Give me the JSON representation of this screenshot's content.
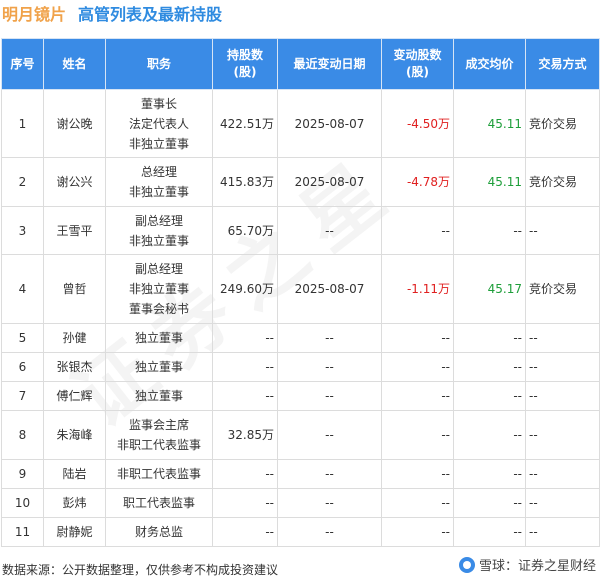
{
  "title": {
    "company": "明月镜片",
    "subtitle": "高管列表及最新持股"
  },
  "headers": {
    "idx": "序号",
    "name": "姓名",
    "role": "职务",
    "shares_1": "持股数",
    "shares_2": "(股)",
    "date": "最近变动日期",
    "chg_1": "变动股数",
    "chg_2": "(股)",
    "price": "成交均价",
    "method": "交易方式"
  },
  "rows": [
    {
      "idx": "1",
      "name": "谢公晚",
      "roles": [
        "董事长",
        "法定代表人",
        "非独立董事"
      ],
      "shares": "422.51万",
      "date": "2025-08-07",
      "change": "-4.50万",
      "price": "45.11",
      "method": "竞价交易"
    },
    {
      "idx": "2",
      "name": "谢公兴",
      "roles": [
        "总经理",
        "非独立董事"
      ],
      "shares": "415.83万",
      "date": "2025-08-07",
      "change": "-4.78万",
      "price": "45.11",
      "method": "竞价交易"
    },
    {
      "idx": "3",
      "name": "王雪平",
      "roles": [
        "副总经理",
        "非独立董事"
      ],
      "shares": "65.70万",
      "date": "--",
      "change": "--",
      "price": "--",
      "method": "--"
    },
    {
      "idx": "4",
      "name": "曾哲",
      "roles": [
        "副总经理",
        "非独立董事",
        "董事会秘书"
      ],
      "shares": "249.60万",
      "date": "2025-08-07",
      "change": "-1.11万",
      "price": "45.17",
      "method": "竞价交易"
    },
    {
      "idx": "5",
      "name": "孙健",
      "roles": [
        "独立董事"
      ],
      "shares": "--",
      "date": "--",
      "change": "--",
      "price": "--",
      "method": "--"
    },
    {
      "idx": "6",
      "name": "张银杰",
      "roles": [
        "独立董事"
      ],
      "shares": "--",
      "date": "--",
      "change": "--",
      "price": "--",
      "method": "--"
    },
    {
      "idx": "7",
      "name": "傅仁辉",
      "roles": [
        "独立董事"
      ],
      "shares": "--",
      "date": "--",
      "change": "--",
      "price": "--",
      "method": "--"
    },
    {
      "idx": "8",
      "name": "朱海峰",
      "roles": [
        "监事会主席",
        "非职工代表监事"
      ],
      "shares": "32.85万",
      "date": "--",
      "change": "--",
      "price": "--",
      "method": "--"
    },
    {
      "idx": "9",
      "name": "陆岩",
      "roles": [
        "非职工代表监事"
      ],
      "shares": "--",
      "date": "--",
      "change": "--",
      "price": "--",
      "method": "--"
    },
    {
      "idx": "10",
      "name": "彭炜",
      "roles": [
        "职工代表监事"
      ],
      "shares": "--",
      "date": "--",
      "change": "--",
      "price": "--",
      "method": "--"
    },
    {
      "idx": "11",
      "name": "尉静妮",
      "roles": [
        "财务总监"
      ],
      "shares": "--",
      "date": "--",
      "change": "--",
      "price": "--",
      "method": "--"
    }
  ],
  "footer": {
    "source": "数据来源：公开数据整理，仅供参考不构成投资建议"
  },
  "brand": {
    "text": "雪球：证券之星财经"
  },
  "watermark": {
    "text": "证券之星"
  },
  "colors": {
    "header_bg": "#3a8be6",
    "title": "#2f8be0",
    "company": "#f0a24a",
    "negative": "#e02020",
    "positive": "#1e9e3a"
  }
}
